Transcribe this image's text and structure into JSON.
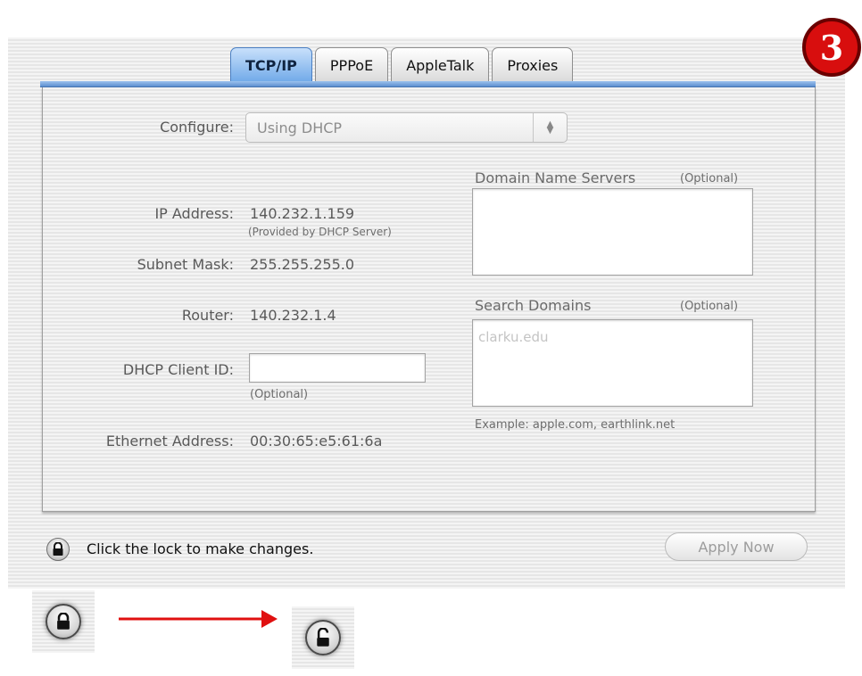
{
  "step_badge": "3",
  "tabs": [
    "TCP/IP",
    "PPPoE",
    "AppleTalk",
    "Proxies"
  ],
  "active_tab": "TCP/IP",
  "configure": {
    "label": "Configure:",
    "value": "Using DHCP"
  },
  "ip_address": {
    "label": "IP Address:",
    "value": "140.232.1.159",
    "note": "(Provided by DHCP Server)"
  },
  "subnet_mask": {
    "label": "Subnet Mask:",
    "value": "255.255.255.0"
  },
  "router": {
    "label": "Router:",
    "value": "140.232.1.4"
  },
  "dhcp_client_id": {
    "label": "DHCP Client ID:",
    "value": "",
    "note": "(Optional)"
  },
  "ethernet_address": {
    "label": "Ethernet Address:",
    "value": "00:30:65:e5:61:6a"
  },
  "dns": {
    "label": "Domain Name Servers",
    "optional": "(Optional)",
    "value": ""
  },
  "search_domains": {
    "label": "Search Domains",
    "optional": "(Optional)",
    "placeholder": "clarku.edu",
    "example": "Example: apple.com, earthlink.net"
  },
  "lock_message": "Click the lock to make changes.",
  "apply_button": "Apply Now",
  "colors": {
    "active_tab": "#6ea8e8",
    "badge": "#d80e0e",
    "arrow": "#e01010"
  },
  "icons": {
    "lock": "lock-icon",
    "unlocked": "unlocked-icon",
    "arrow": "right-arrow-icon",
    "select_arrows": "select-arrows-icon"
  }
}
